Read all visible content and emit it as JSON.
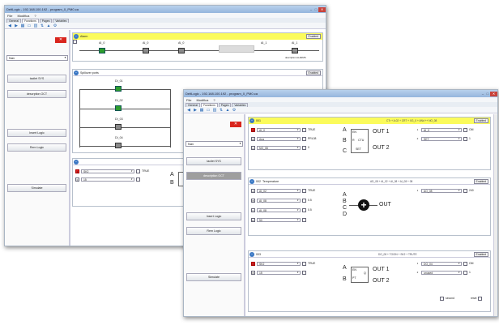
{
  "back_window": {
    "title": "DeltLogic - 192.168.100.192 - program_0_PM0.ca",
    "menu": [
      "File",
      "Modifica",
      "?"
    ],
    "tabs": [
      "General",
      "Functions",
      "Pages",
      "Variables"
    ],
    "filter_value": "Nav",
    "left_buttons": [
      "tacilet SYS",
      "descrption OCT",
      "Insert Logic",
      "Rem Logic",
      "Simulate"
    ],
    "block1": {
      "title": "Alarm",
      "enable": "Enabled",
      "labels": [
        "AI_0",
        "AI_0",
        "AI_0",
        "AI_1",
        "AI_1"
      ],
      "sublabel": "description ALARMS"
    },
    "block2": {
      "title": "Spillover ports",
      "enable": "Enabled",
      "labels": [
        "DI_01",
        "DI_02",
        "DI_03",
        "DI_04"
      ]
    },
    "block3": {
      "title": "",
      "row1": {
        "num": "1",
        "value": "SK2",
        "chk": "TRUE"
      },
      "row2": {
        "num": "0",
        "value": "15"
      },
      "gate_a": "A",
      "gate_b": "B"
    }
  },
  "front_window": {
    "title": "DeltLogic - 192.168.100.192 - program_0_PM0.ca",
    "menu": [
      "File",
      "Modifica",
      "?"
    ],
    "tabs": [
      "General",
      "Functions",
      "Pages",
      "Variables"
    ],
    "filter_value": "Nav",
    "left_buttons": [
      "tacilet SYS",
      "description OCT",
      "Insert Logic",
      "Rem Logic",
      "Simulate"
    ],
    "block1": {
      "id": "001",
      "title": "",
      "note": "CTr + A.02 + CRT + XG_0 + ANd ++ NO_08",
      "enable": "Enabled",
      "left_rows": [
        {
          "sq": "A",
          "value": "AI_0",
          "chk": "TRUE"
        },
        {
          "sq": "B",
          "value": "Ana",
          "chk": "PRL08"
        },
        {
          "sq": "C",
          "value": "NO_08",
          "chk": "0"
        }
      ],
      "right_rows": [
        {
          "n": "1",
          "value": "AI_0",
          "chk": "OM"
        },
        {
          "n": "2",
          "value": "SET",
          "chk": "1"
        }
      ],
      "gate_inputs": [
        "A",
        "B",
        "C"
      ],
      "gate_labels": [
        "EN",
        "R",
        "CTU",
        "SET"
      ],
      "outputs": [
        "OUT 1",
        "OUT 2"
      ]
    },
    "block2": {
      "id": "002",
      "title": "Temperature",
      "note": "AD_08 + AI_02 + AI_08 + AI_08 + 08",
      "enable": "Enabled",
      "left_rows": [
        {
          "sq": "A",
          "value": "AI_02",
          "chk": "TRUE"
        },
        {
          "sq": "B",
          "value": "AI_08",
          "chk": "0.5"
        },
        {
          "sq": "C",
          "value": "AI_08",
          "chk": "0.5"
        },
        {
          "sq": "D",
          "value": "50",
          "chk": ""
        }
      ],
      "right_rows": [
        {
          "n": "1",
          "value": "AO_08",
          "chk": "240"
        }
      ],
      "gate_inputs": [
        "A",
        "B",
        "C",
        "D"
      ],
      "output": "OUT",
      "plus": "+"
    },
    "block3": {
      "id": "003",
      "title": "",
      "note": "DO_08 + TO/ON + SK2 + TRUTE",
      "enable": "Enabled",
      "left_rows": [
        {
          "sq": "A",
          "value": "SK2",
          "chk": "TRUE"
        },
        {
          "sq": "B",
          "value": "15",
          "chk": ""
        }
      ],
      "right_rows": [
        {
          "n": "1",
          "value": "DO_04",
          "chk": "OM"
        },
        {
          "n": "2",
          "value": "unused",
          "chk": "1"
        }
      ],
      "gate_inputs": [
        "A",
        "B"
      ],
      "gate_labels": [
        "EN",
        "PT",
        "Q"
      ],
      "outputs": [
        "OUT 1",
        "OUT 2"
      ]
    },
    "footer": {
      "left_label": "second",
      "right_label": "reset"
    }
  },
  "colors": {
    "header_yellow": "#fbfb5b",
    "input_red": "#e02020",
    "title_blue": "#95b5dd",
    "close_red": "#c8423a",
    "led_green": "#2d9c2d"
  }
}
